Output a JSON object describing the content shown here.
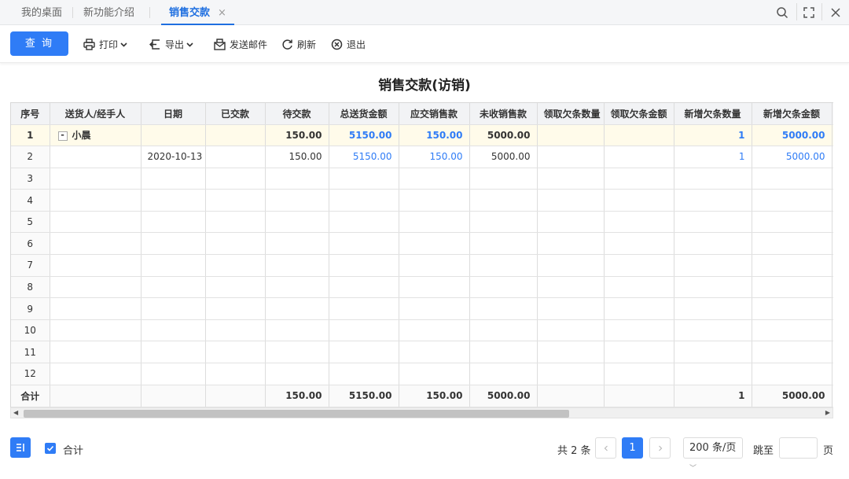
{
  "tabs": [
    {
      "label": "我的桌面"
    },
    {
      "label": "新功能介绍"
    },
    {
      "label": "销售交款",
      "close": "×"
    }
  ],
  "toolbar": {
    "query_label": "查 询",
    "print_label": "打印",
    "export_label": "导出",
    "email_label": "发送邮件",
    "refresh_label": "刷新",
    "exit_label": "退出"
  },
  "report": {
    "title": "销售交款(访销)"
  },
  "table": {
    "headers": [
      "序号",
      "送货人/经手人",
      "日期",
      "已交款",
      "待交款",
      "总送货金额",
      "应交销售款",
      "未收销售款",
      "领取欠条数量",
      "领取欠条金额",
      "新增欠条数量",
      "新增欠条金额"
    ],
    "rows": [
      {
        "idx": "1",
        "tree": "-",
        "person": "小晨",
        "date": "",
        "paid": "",
        "pending": "150.00",
        "total": "5150.00",
        "due": "150.00",
        "unreceived": "5000.00",
        "recv_count": "",
        "recv_amount": "",
        "new_count": "1",
        "new_amount": "5000.00"
      },
      {
        "idx": "2",
        "tree": "",
        "person": "",
        "date": "2020-10-13",
        "paid": "",
        "pending": "150.00",
        "total": "5150.00",
        "due": "150.00",
        "unreceived": "5000.00",
        "recv_count": "",
        "recv_amount": "",
        "new_count": "1",
        "new_amount": "5000.00"
      },
      {
        "idx": "3"
      },
      {
        "idx": "4"
      },
      {
        "idx": "5"
      },
      {
        "idx": "6"
      },
      {
        "idx": "7"
      },
      {
        "idx": "8"
      },
      {
        "idx": "9"
      },
      {
        "idx": "10"
      },
      {
        "idx": "11"
      },
      {
        "idx": "12"
      }
    ],
    "total": {
      "label": "合计",
      "pending": "150.00",
      "total": "5150.00",
      "due": "150.00",
      "unreceived": "5000.00",
      "new_count": "1",
      "new_amount": "5000.00"
    }
  },
  "footer": {
    "checkbox_label": "合计",
    "total_count": "共 2 条",
    "current_page": "1",
    "page_size": "200 条/页",
    "jump_label": "跳至",
    "page_suffix": "页"
  },
  "colors": {
    "accent": "#2f7cf6",
    "group_row": "#fffbea"
  }
}
